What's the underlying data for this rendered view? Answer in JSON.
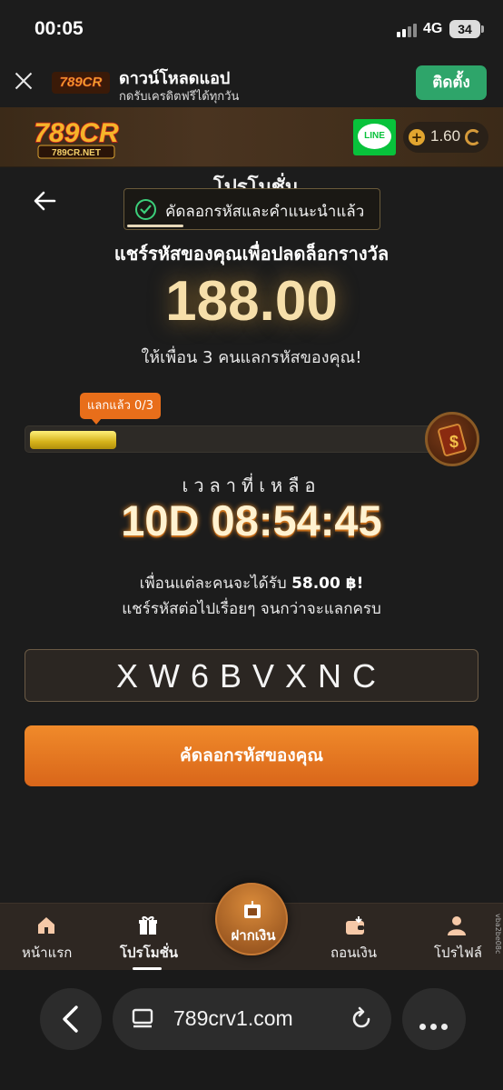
{
  "status_bar": {
    "time": "00:05",
    "network": "4G",
    "battery": "34"
  },
  "app_banner": {
    "title": "ดาวน์โหลดแอป",
    "subtitle": "กดรับเครดิตฟรีได้ทุกวัน",
    "install_label": "ติดตั้ง",
    "logo_text": "789CR"
  },
  "header": {
    "logo_text": "789CR",
    "logo_sub": "789CR.NET",
    "line_label": "LINE",
    "balance": "1.60",
    "icons": [
      "line-icon",
      "coin-icon",
      "refresh-icon"
    ]
  },
  "page": {
    "title": "โปรโมชั่น",
    "toast": "คัดลอกรหัสและคำแนะนำแล้ว",
    "heading": "แชร์รหัสของคุณเพื่อปลดล็อกรางวัล",
    "reward_amount": "188.00",
    "invite_text": "ให้เพื่อน 3 คนแลกรหัสของคุณ!"
  },
  "progress": {
    "badge_label": "แลกแล้ว",
    "badge_count": "0/3",
    "fraction": 0.21
  },
  "timer": {
    "label": "เวลาที่เหลือ",
    "value": "10D 08:54:45"
  },
  "info": {
    "each_prefix": "เพื่อนแต่ละคนจะได้รับ",
    "each_amount": "58.00 ฿!",
    "keep_sharing": "แชร์รหัสต่อไปเรื่อยๆ จนกว่าจะแลกครบ"
  },
  "code": {
    "value": "XW6BVXNC"
  },
  "copy_button": {
    "label": "คัดลอกรหัสของคุณ"
  },
  "bottom_nav": {
    "home": "หน้าแรก",
    "promotions": "โปรโมชั่น",
    "deposit": "ฝากเงิน",
    "withdraw": "ถอนเงิน",
    "profile": "โปรไฟล์"
  },
  "side_tag": "vba2be08c",
  "browser": {
    "url": "789crv1.com"
  },
  "colors": {
    "accent": "#e8761e",
    "success": "#2ea56a",
    "gold": "#f6dfaa",
    "line_green": "#08c23b"
  }
}
